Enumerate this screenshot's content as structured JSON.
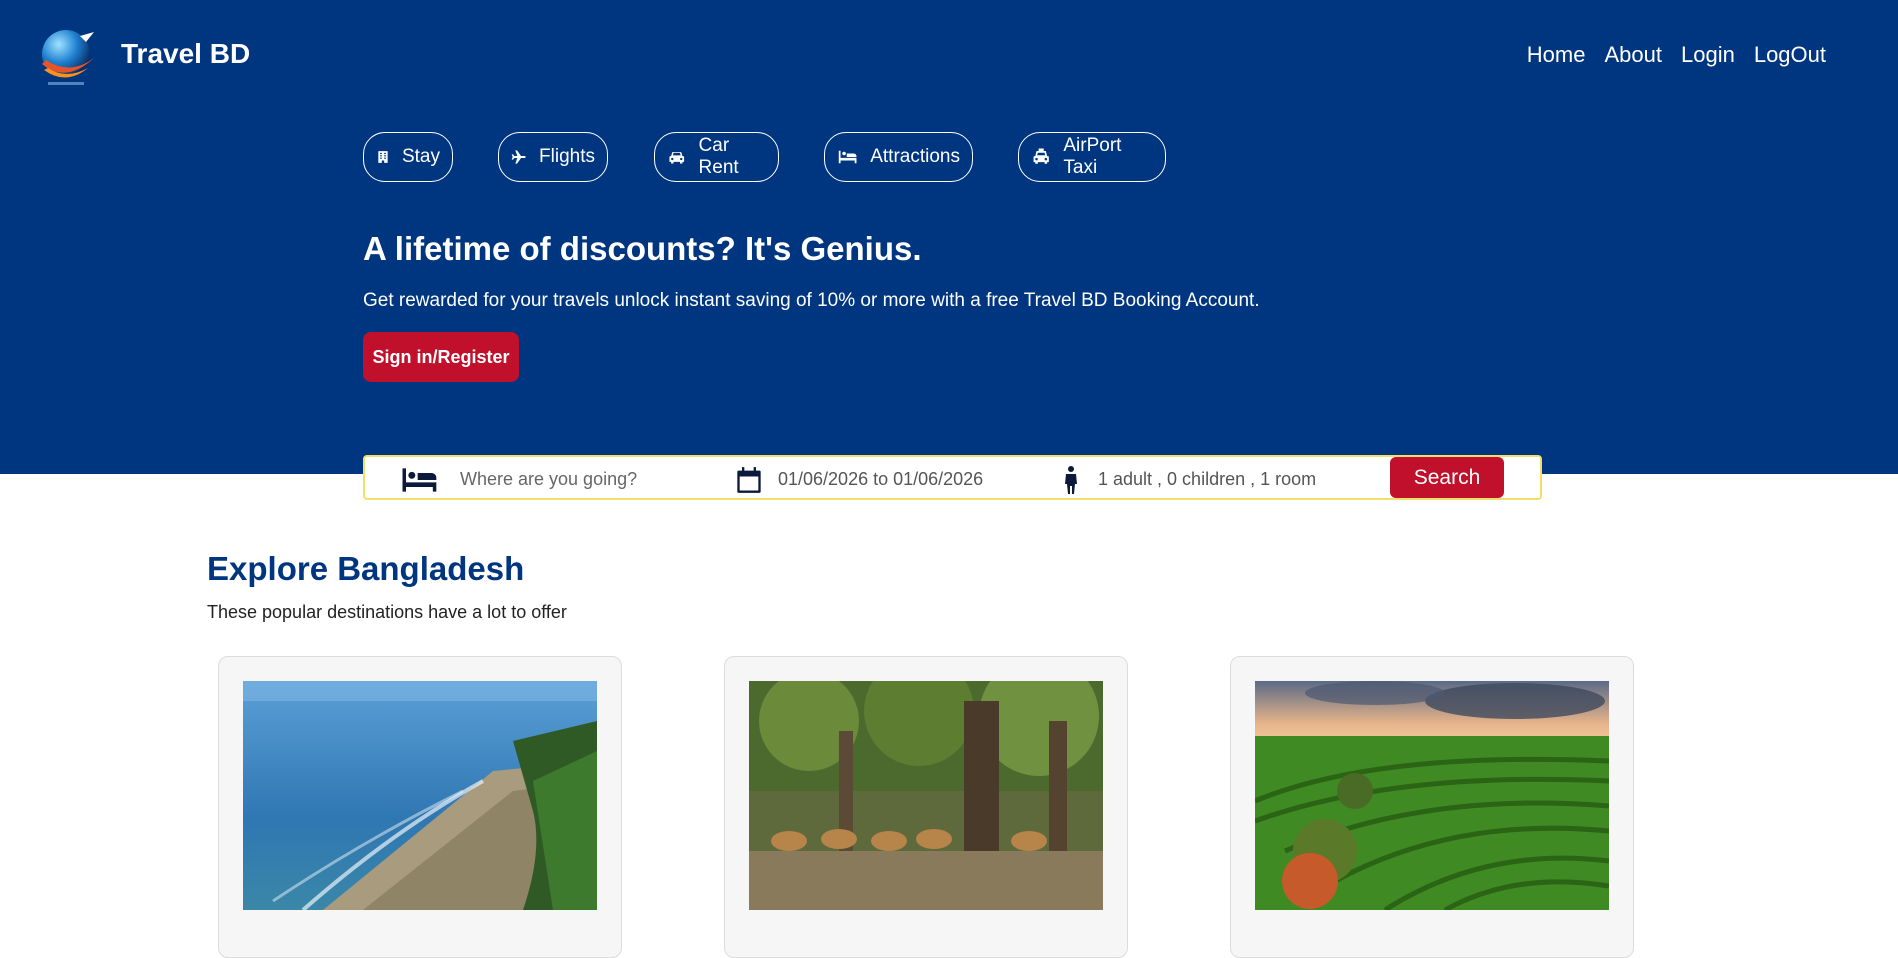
{
  "brand": {
    "name": "Travel BD"
  },
  "nav": {
    "home": "Home",
    "about": "About",
    "login": "Login",
    "logout": "LogOut"
  },
  "categories": [
    {
      "label": "Stay",
      "icon": "building-icon"
    },
    {
      "label": "Flights",
      "icon": "plane-icon"
    },
    {
      "label": "Car Rent",
      "icon": "car-icon"
    },
    {
      "label": "Attractions",
      "icon": "bed-icon"
    },
    {
      "label": "AirPort Taxi",
      "icon": "taxi-icon"
    }
  ],
  "hero": {
    "headline": "A lifetime of discounts? It's Genius.",
    "subtext": "Get rewarded for your travels unlock instant saving of 10% or more with a free Travel BD Booking Account.",
    "cta": "Sign in/Register"
  },
  "search": {
    "destination_placeholder": "Where are you going?",
    "dates": "01/06/2026 to 01/06/2026",
    "guests": "1 adult , 0 children , 1 room",
    "button": "Search"
  },
  "explore": {
    "title": "Explore Bangladesh",
    "subtitle": "These popular destinations have a lot to offer"
  },
  "colors": {
    "primary": "#003580",
    "accent": "#c0102b",
    "searchBorder": "#f2df6a"
  }
}
